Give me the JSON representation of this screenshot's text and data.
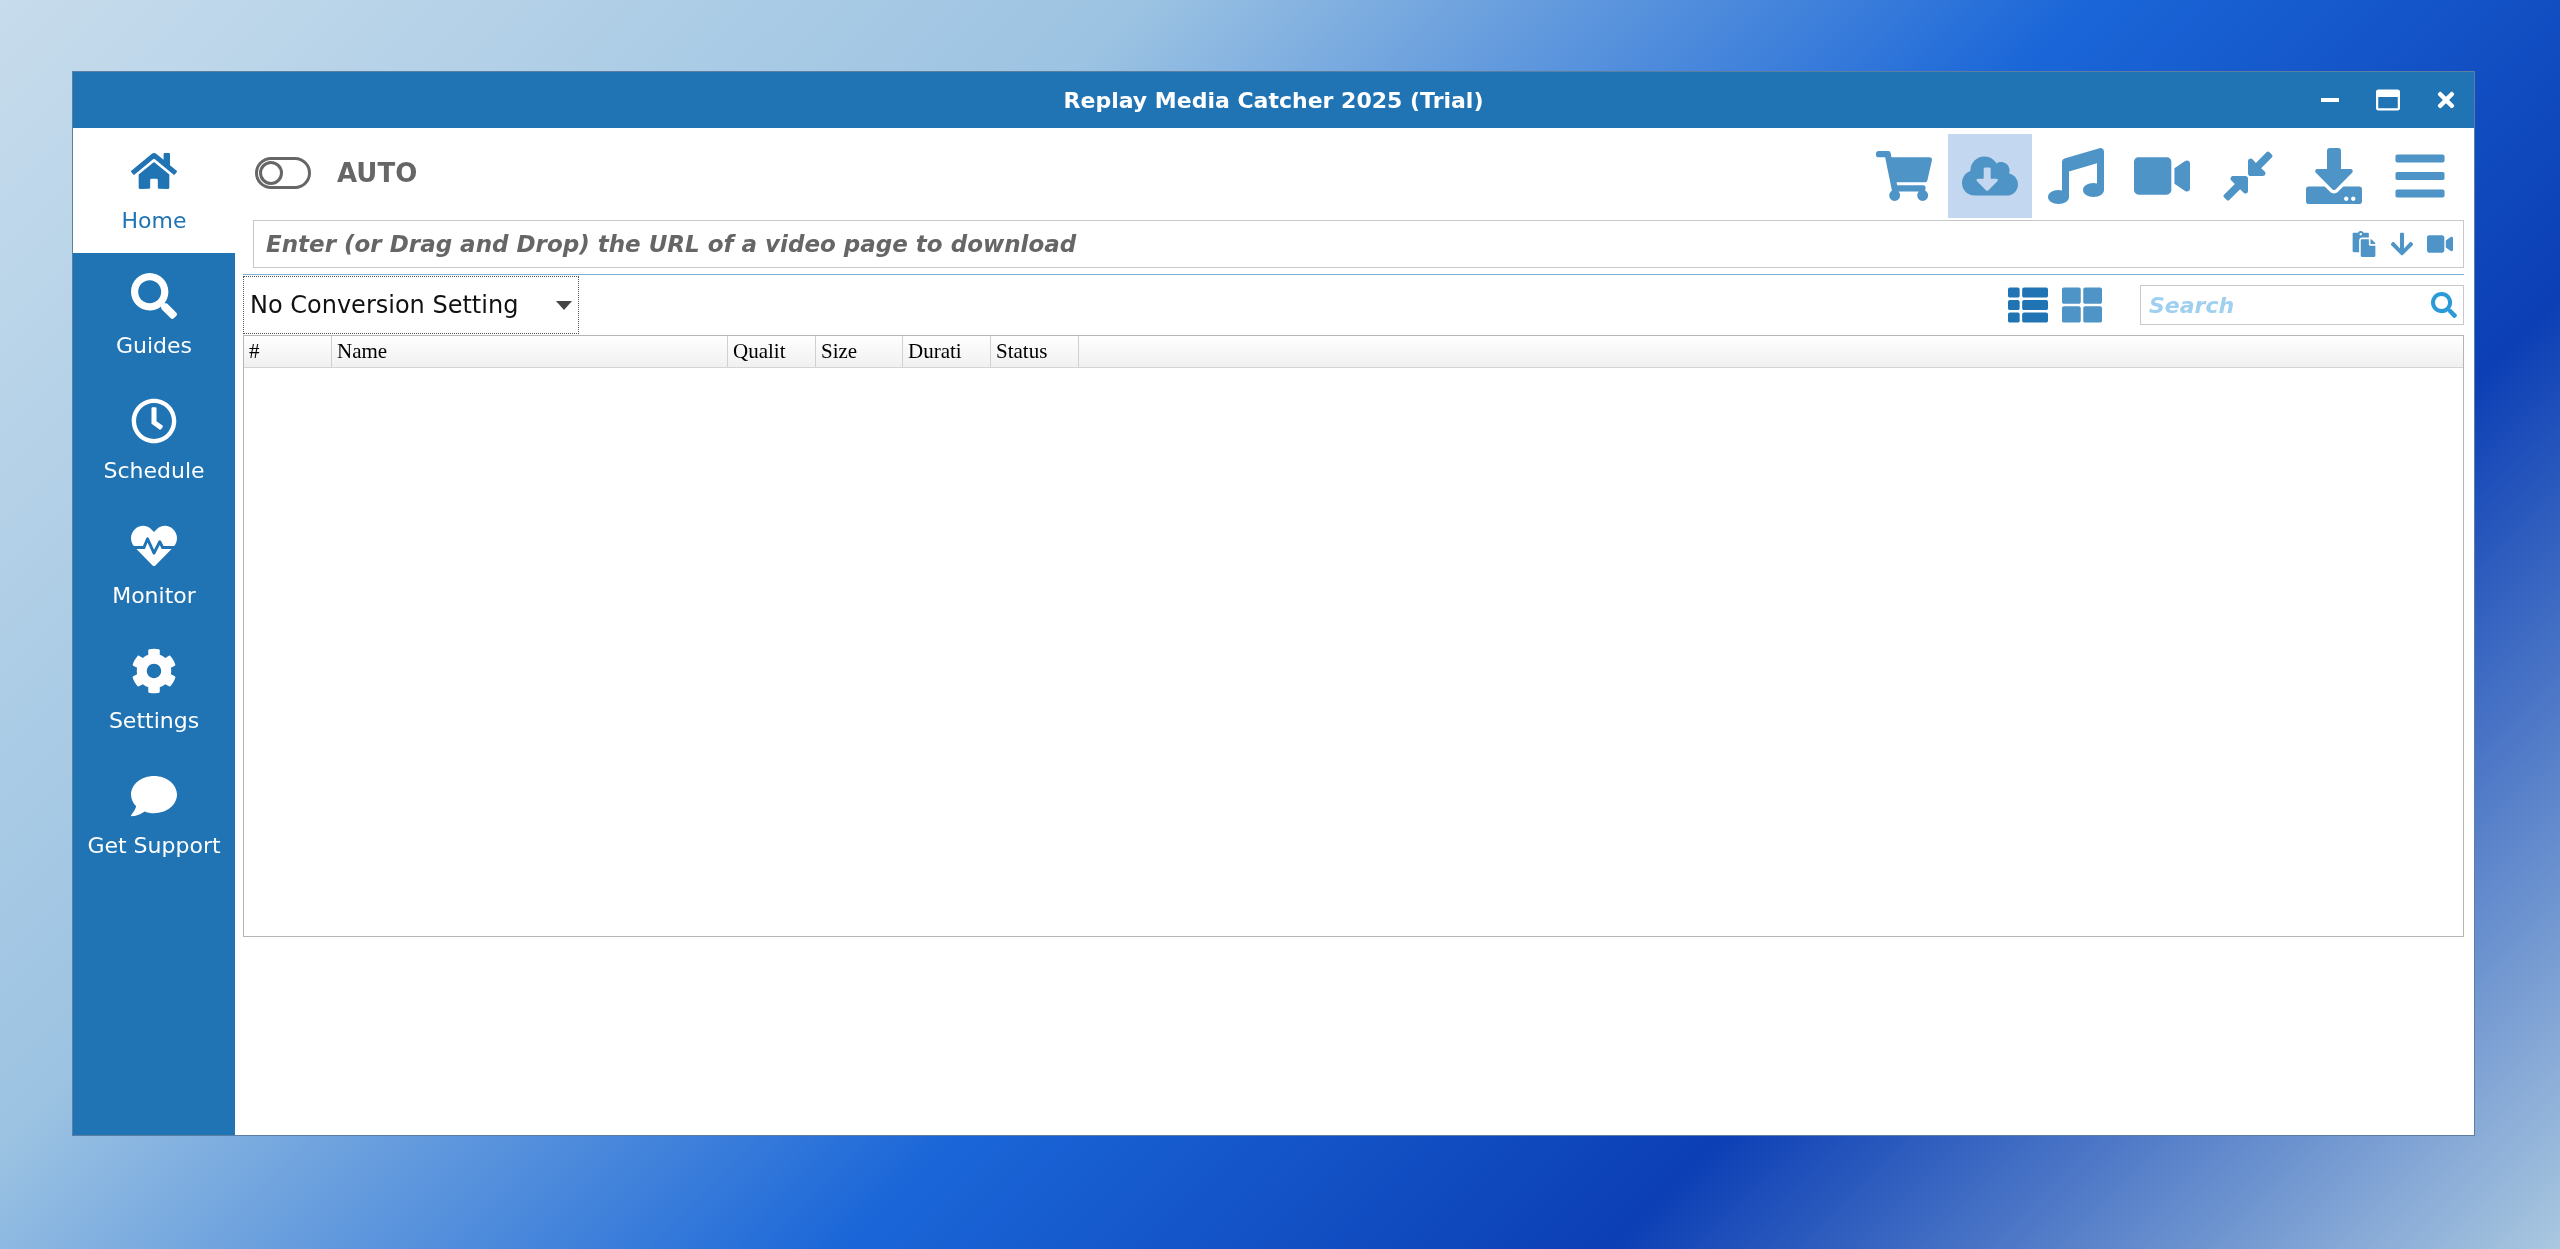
{
  "window": {
    "title": "Replay Media Catcher 2025 (Trial)"
  },
  "sidebar": {
    "items": [
      {
        "kind": "home",
        "label": "Home",
        "selected": true
      },
      {
        "kind": "guides",
        "label": "Guides",
        "selected": false
      },
      {
        "kind": "schedule",
        "label": "Schedule",
        "selected": false
      },
      {
        "kind": "monitor",
        "label": "Monitor",
        "selected": false
      },
      {
        "kind": "settings",
        "label": "Settings",
        "selected": false
      },
      {
        "kind": "support",
        "label": "Get Support",
        "selected": false
      }
    ]
  },
  "auto_toggle": {
    "label": "AUTO",
    "on": false
  },
  "toolbar": [
    {
      "kind": "cart",
      "selected": false
    },
    {
      "kind": "cloud",
      "selected": true
    },
    {
      "kind": "music",
      "selected": false
    },
    {
      "kind": "video",
      "selected": false
    },
    {
      "kind": "compress",
      "selected": false
    },
    {
      "kind": "download",
      "selected": false
    },
    {
      "kind": "menu",
      "selected": false
    }
  ],
  "url_field": {
    "placeholder": "Enter (or Drag and Drop) the URL of a video page to download"
  },
  "conversion_dropdown": {
    "value": "No Conversion Setting"
  },
  "view_buttons": [
    {
      "kind": "list",
      "selected": true
    },
    {
      "kind": "grid",
      "selected": false
    }
  ],
  "search": {
    "placeholder": "Search"
  },
  "table": {
    "columns": [
      "#",
      "Name",
      "Qualit",
      "Size",
      "Durati",
      "Status"
    ]
  }
}
